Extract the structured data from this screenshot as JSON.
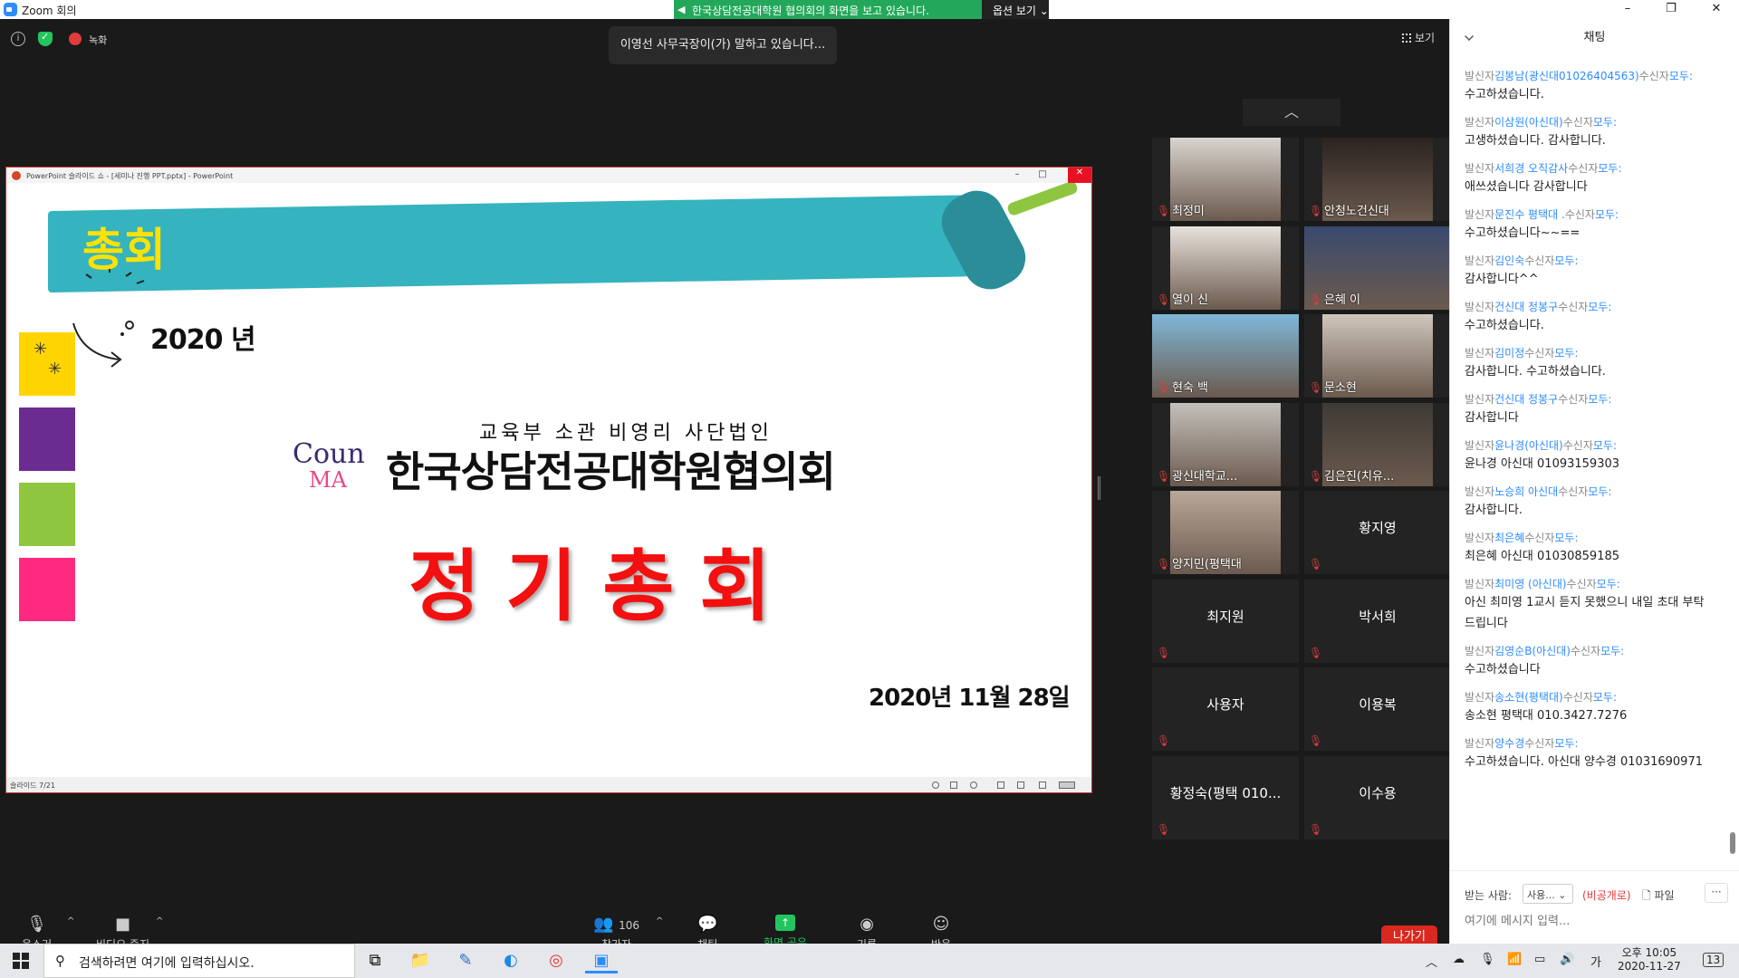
{
  "window": {
    "title": "Zoom 회의",
    "minimize_icon": "minimize-icon",
    "maximize_icon": "restore-icon",
    "close_icon": "close-icon"
  },
  "share_banner": {
    "text": "한국상담전공대학원 협의회의 화면을 보고 있습니다.",
    "options_label": "옵션 보기"
  },
  "meeting_top": {
    "record_label": "녹화",
    "speaking": "이영선 사무국장이(가) 말하고 있습니다...",
    "view_label": "보기"
  },
  "powerpoint": {
    "title": "PowerPoint 슬라이드 쇼 - [세미나 진행 PPT.pptx] - PowerPoint",
    "status": "슬라이드 7/21"
  },
  "slide": {
    "banner_title": "총회",
    "year": "2020 년",
    "subtitle": "교육부 소관 비영리 사단법인",
    "logo_top": "Coun",
    "logo_bottom": "MA",
    "org_name": "한국상담전공대학원협의회",
    "event": "정기총회",
    "date": "2020년 11월 28일"
  },
  "participants": [
    {
      "name": "최정미",
      "has_video": true
    },
    {
      "name": "안청노건신대",
      "has_video": true
    },
    {
      "name": "열이 신",
      "has_video": true
    },
    {
      "name": "은혜 이",
      "has_video": true
    },
    {
      "name": "현숙 백",
      "has_video": true
    },
    {
      "name": "문소현",
      "has_video": true
    },
    {
      "name": "광신대학교...",
      "has_video": true
    },
    {
      "name": "김은진(치유...",
      "has_video": true
    },
    {
      "name": "양지민(평택대",
      "has_video": true
    },
    {
      "name": "황지영",
      "has_video": false
    },
    {
      "name": "최지원",
      "has_video": false
    },
    {
      "name": "박서희",
      "has_video": false
    },
    {
      "name": "사용자",
      "has_video": false
    },
    {
      "name": "이용복",
      "has_video": false
    },
    {
      "name": "황정숙(평택 010...",
      "has_video": false
    },
    {
      "name": "이수용",
      "has_video": false
    }
  ],
  "toolbar": {
    "mute": "음소거",
    "video": "비디오 중지",
    "participants": "참가자",
    "participants_count": "106",
    "chat": "채팅",
    "share": "화면 공유",
    "record": "기록",
    "reactions": "반응",
    "leave": "나가기"
  },
  "chat": {
    "title": "채팅",
    "messages": [
      {
        "sender": "김봉남(광신대01026404563)",
        "body": "수고하셨습니다."
      },
      {
        "sender": "이삼원(아신대)",
        "body": "고생하셨습니다. 감사합니다."
      },
      {
        "sender": "서희경 오직감사",
        "body": "애쓰셨습니다 감사합니다"
      },
      {
        "sender": "문진수 평택대 .",
        "body": "수고하셨습니다~~=="
      },
      {
        "sender": "김인숙",
        "body": "감사합니다^^"
      },
      {
        "sender": "건신대 정봉구",
        "body": "수고하셨습니다."
      },
      {
        "sender": "김미정",
        "body": "감사합니다. 수고하셨습니다."
      },
      {
        "sender": "건신대 정봉구",
        "body": "감사합니다"
      },
      {
        "sender": "윤나경(아신대)",
        "body": "윤나경 아신대 01093159303"
      },
      {
        "sender": "노승희 아신대",
        "body": "감사합니다."
      },
      {
        "sender": "최은혜",
        "body": "최은혜 아신대 01030859185"
      },
      {
        "sender": "최미영 (아신대)",
        "body": "아신 최미영 1교시 듣지 못했으니 내일 초대 부탁드립니다"
      },
      {
        "sender": "김영순B(아신대)",
        "body": "수고하셨습니다"
      },
      {
        "sender": "송소현(평택대)",
        "body": "송소현 평택대 010.3427.7276"
      },
      {
        "sender": "양수경",
        "body": "수고하셨습니다. 아신대 양수경 01031690971"
      }
    ],
    "prefix_sender": "발신자",
    "prefix_receiver": "수신자",
    "receiver": "모두",
    "to_label": "받는 사람:",
    "to_value": "사용...",
    "private_label": "(비공개로)",
    "file_label": "파일",
    "more_label": "···",
    "input_placeholder": "여기에 메시지 입력..."
  },
  "taskbar": {
    "search_placeholder": "검색하려면 여기에 입력하십시오.",
    "ime": "가",
    "time": "오후 10:05",
    "date": "2020-11-27",
    "notifications": "13"
  }
}
